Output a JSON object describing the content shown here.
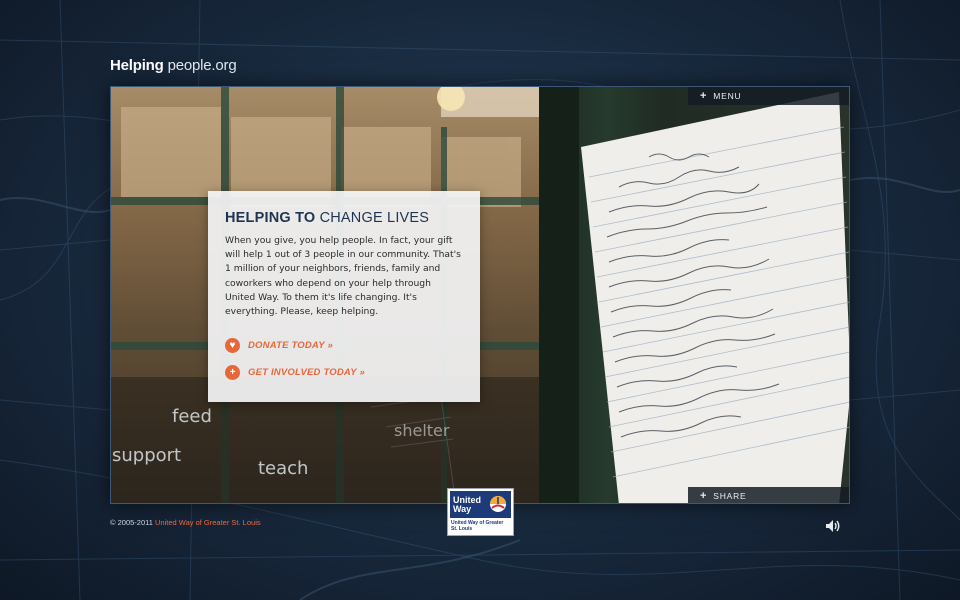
{
  "site": {
    "logo_bold": "Helping",
    "logo_light": "people.org"
  },
  "nav": {
    "menu_label": "MENU",
    "share_label": "SHARE"
  },
  "hero": {
    "heading_bold": "HELPING TO",
    "heading_light": "CHANGE LIVES",
    "body": "When you give, you help people. In fact, your gift will help 1 out of 3 people in our community. That's 1 million of your neighbors, friends, family and coworkers who depend on your help through United Way. To them it's life changing. It's everything. Please, keep helping.",
    "donate_label": "DONATE TODAY »",
    "involved_label": "GET INVOLVED TODAY »"
  },
  "overlay_words": {
    "feed": "feed",
    "support": "support",
    "teach": "teach",
    "shelter": "shelter"
  },
  "footer": {
    "copyright": "© 2005-2011",
    "org_link": "United Way of Greater St. Louis"
  },
  "badge": {
    "title": "United Way",
    "subtitle": "United Way of Greater St. Louis"
  },
  "colors": {
    "accent": "#e8673a",
    "heading": "#1d3552",
    "background": "#18293d"
  },
  "icons": {
    "menu": "plus-icon",
    "share": "plus-icon",
    "donate": "heart-icon",
    "involved": "plus-circle-icon",
    "sound": "speaker-icon"
  }
}
